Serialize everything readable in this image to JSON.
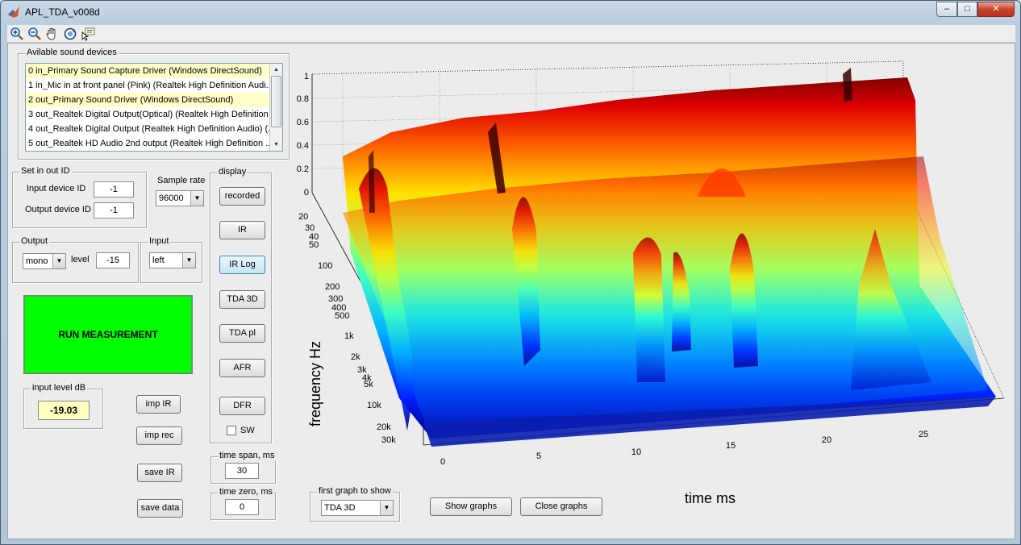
{
  "window": {
    "title": "APL_TDA_v008d",
    "controls": {
      "minimize": "–",
      "maximize": "□",
      "close": "✕"
    }
  },
  "toolbar": {
    "tools": [
      "zoom-in-icon",
      "zoom-out-icon",
      "pan-hand-icon",
      "rotate-3d-icon",
      "data-cursor-icon"
    ]
  },
  "devices": {
    "title": "Avilable sound devices",
    "items": [
      "0 in_Primary Sound Capture Driver (Windows DirectSound)",
      "1 in_Mic in at front panel (Pink) (Realtek High Definition Audi...",
      "2 out_Primary Sound Driver (Windows DirectSound)",
      "3 out_Realtek Digital Output(Optical) (Realtek High Definition ...",
      "4 out_Realtek Digital Output (Realtek High Definition Audio) (...",
      "5 out_Realtek HD Audio 2nd output (Realtek High Definition ..."
    ]
  },
  "io_id": {
    "title": "Set in out ID",
    "input_label": "Input device ID",
    "input_value": "-1",
    "output_label": "Output device ID",
    "output_value": "-1"
  },
  "sample_rate": {
    "label": "Sample rate",
    "value": "96000"
  },
  "output": {
    "title": "Output",
    "mode": "mono",
    "level_label": "level",
    "level_value": "-15"
  },
  "input": {
    "title": "Input",
    "channel": "left"
  },
  "run_button": "RUN MEASUREMENT",
  "input_level": {
    "title": "input level dB",
    "value": "-19.03"
  },
  "buttons": {
    "imp_ir": "imp IR",
    "imp_rec": "imp rec",
    "save_ir": "save IR",
    "save_data": "save data"
  },
  "display": {
    "title": "display",
    "buttons": [
      "recorded",
      "IR",
      "IR Log",
      "TDA 3D",
      "TDA pl",
      "AFR",
      "DFR"
    ],
    "active": "IR Log",
    "sw_label": "SW"
  },
  "time_span": {
    "title": "time span, ms",
    "value": "30"
  },
  "time_zero": {
    "title": "time zero, ms",
    "value": "0"
  },
  "first_graph": {
    "title": "first graph to show",
    "value": "TDA 3D"
  },
  "graph_buttons": {
    "show": "Show graphs",
    "close": "Close graphs"
  },
  "plot": {
    "z_ticks": [
      "1",
      "0.8",
      "0.6",
      "0.4",
      "0.2",
      "0"
    ],
    "freq_ticks": [
      "20",
      "30",
      "40",
      "50",
      "100",
      "200",
      "300",
      "400",
      "500",
      "1k",
      "2k",
      "3k",
      "4k",
      "5k",
      "10k",
      "20k",
      "30k"
    ],
    "time_ticks": [
      "0",
      "5",
      "10",
      "15",
      "20",
      "25"
    ],
    "y_label": "frequency   Hz",
    "x_label": "time   ms"
  },
  "colors": {
    "run_button": "#00ff00",
    "level_box": "#ffffc0",
    "list_highlight": "#ffffc8"
  }
}
